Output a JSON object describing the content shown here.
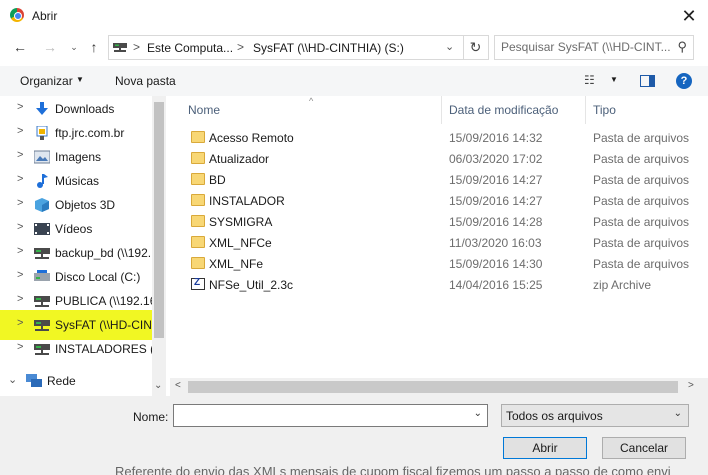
{
  "window": {
    "title": "Abrir",
    "close_label": "✕"
  },
  "nav": {
    "back": "←",
    "forward": "→",
    "recent": "⌄",
    "up": "↑",
    "address": {
      "separator": ">",
      "crumbs": [
        "Este Computa...",
        "SysFAT (\\\\HD-CINTHIA) (S:)"
      ],
      "dropdown": "⌄"
    },
    "refresh": "↻",
    "search": {
      "placeholder": "Pesquisar SysFAT (\\\\HD-CINT...",
      "icon": "search-icon"
    }
  },
  "toolbar": {
    "organize_label": "Organizar",
    "new_folder_label": "Nova pasta",
    "view_icon": "☷",
    "help_label": "?"
  },
  "sidebar": {
    "items": [
      {
        "label": "Downloads",
        "icon": "download-icon"
      },
      {
        "label": "ftp.jrc.com.br",
        "icon": "network-location-icon"
      },
      {
        "label": "Imagens",
        "icon": "pictures-icon"
      },
      {
        "label": "Músicas",
        "icon": "music-icon"
      },
      {
        "label": "Objetos 3D",
        "icon": "3d-objects-icon"
      },
      {
        "label": "Vídeos",
        "icon": "videos-icon"
      },
      {
        "label": "backup_bd (\\\\192.",
        "icon": "network-drive-icon"
      },
      {
        "label": "Disco Local (C:)",
        "icon": "local-disk-icon"
      },
      {
        "label": "PUBLICA (\\\\192.16",
        "icon": "network-drive-icon"
      },
      {
        "label": "SysFAT (\\\\HD-CIN",
        "icon": "network-drive-icon",
        "selected": true
      },
      {
        "label": "INSTALADORES (\\\\",
        "icon": "network-drive-icon"
      },
      {
        "label": "Rede",
        "icon": "network-icon",
        "expanded": true
      }
    ]
  },
  "columns": {
    "name": "Nome",
    "date": "Data de modificação",
    "type": "Tipo"
  },
  "files": [
    {
      "name": "Acesso Remoto",
      "date": "15/09/2016 14:32",
      "type": "Pasta de arquivos",
      "kind": "folder"
    },
    {
      "name": "Atualizador",
      "date": "06/03/2020 17:02",
      "type": "Pasta de arquivos",
      "kind": "folder"
    },
    {
      "name": "BD",
      "date": "15/09/2016 14:27",
      "type": "Pasta de arquivos",
      "kind": "folder"
    },
    {
      "name": "INSTALADOR",
      "date": "15/09/2016 14:27",
      "type": "Pasta de arquivos",
      "kind": "folder"
    },
    {
      "name": "SYSMIGRA",
      "date": "15/09/2016 14:28",
      "type": "Pasta de arquivos",
      "kind": "folder"
    },
    {
      "name": "XML_NFCe",
      "date": "11/03/2020 16:03",
      "type": "Pasta de arquivos",
      "kind": "folder"
    },
    {
      "name": "XML_NFe",
      "date": "15/09/2016 14:30",
      "type": "Pasta de arquivos",
      "kind": "folder"
    },
    {
      "name": "NFSe_Util_2.3c",
      "date": "14/04/2016 15:25",
      "type": "zip Archive",
      "kind": "zip"
    }
  ],
  "footer": {
    "name_label": "Nome:",
    "name_value": "",
    "file_type": "Todos os arquivos",
    "open_label": "Abrir",
    "cancel_label": "Cancelar"
  },
  "background_text": "Referente do envio das XMLs mensais de cupom fiscal fizemos um passo a passo de como envi",
  "colors": {
    "selection": "#f1f723",
    "accent": "#0078d7",
    "folder": "#f8d775"
  }
}
